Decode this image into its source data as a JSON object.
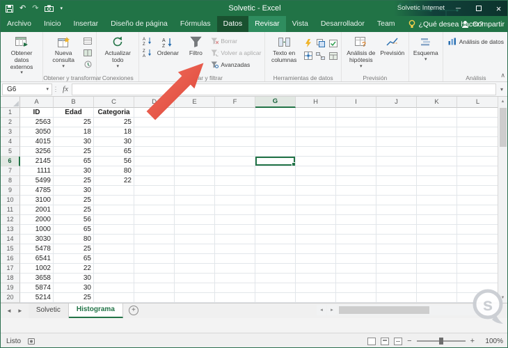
{
  "colors": {
    "excel_green": "#217346",
    "active_tab": "#19512f",
    "hover_tab": "#2f8d5f",
    "titlebar_dark": "#0c332c",
    "annotation_arrow_red": "#e8544a",
    "selection_green": "#217346"
  },
  "window": {
    "title": "Solvetic - Excel",
    "network_label": "Solvetic Internet"
  },
  "icons": {
    "undo": "↶",
    "redo": "↷",
    "caret": "▾",
    "minimize": "─",
    "close": "×",
    "left_arrow": "◄",
    "right_arrow": "►",
    "up_arrow": "▲",
    "down_arrow": "▼",
    "ellipsis": "⋮",
    "collapse_ribbon": "∧"
  },
  "ribbon_tabs": {
    "items": [
      "Archivo",
      "Inicio",
      "Insertar",
      "Diseño de página",
      "Fórmulas",
      "Datos",
      "Revisar",
      "Vista",
      "Desarrollador",
      "Team"
    ],
    "active": "Datos",
    "hovered": "Revisar",
    "tell_me": "¿Qué desea hacer?",
    "share": "Compartir"
  },
  "ribbon": {
    "groups": {
      "get_transform": "Obtener y transformar",
      "connections": "Conexiones",
      "sort_filter": "Ordenar y filtrar",
      "data_tools": "Herramientas de datos",
      "forecast": "Previsión",
      "analysis": "Análisis"
    },
    "buttons": {
      "get_external": "Obtener datos externos",
      "new_query": "Nueva consulta",
      "refresh_all": "Actualizar todo",
      "sort": "Ordenar",
      "filter": "Filtro",
      "clear": "Borrar",
      "reapply": "Volver a aplicar",
      "advanced": "Avanzadas",
      "text_to_columns": "Texto en columnas",
      "what_if": "Análisis de hipótesis",
      "forecast_sheet": "Previsión",
      "outline": "Esquema",
      "data_analysis": "Análisis de datos"
    }
  },
  "formula_bar": {
    "name_box": "G6",
    "fx": "fx",
    "formula": ""
  },
  "grid": {
    "columns": [
      "A",
      "B",
      "C",
      "D",
      "E",
      "F",
      "G",
      "H",
      "I",
      "J",
      "K",
      "L"
    ],
    "row_count": 20,
    "selected": {
      "col": "G",
      "row": 6
    },
    "cells": [
      [
        "ID",
        "Edad",
        "Categoria"
      ],
      [
        2563,
        25,
        25
      ],
      [
        3050,
        18,
        18
      ],
      [
        4015,
        30,
        30
      ],
      [
        3256,
        25,
        65
      ],
      [
        2145,
        65,
        56
      ],
      [
        1111,
        30,
        80
      ],
      [
        5499,
        25,
        22
      ],
      [
        4785,
        30,
        null
      ],
      [
        3100,
        25,
        null
      ],
      [
        2001,
        25,
        null
      ],
      [
        2000,
        56,
        null
      ],
      [
        1000,
        65,
        null
      ],
      [
        3030,
        80,
        null
      ],
      [
        5478,
        25,
        null
      ],
      [
        6541,
        65,
        null
      ],
      [
        1002,
        22,
        null
      ],
      [
        3658,
        30,
        null
      ],
      [
        5874,
        30,
        null
      ],
      [
        5214,
        25,
        null
      ]
    ]
  },
  "sheet_tabs": {
    "tabs": [
      {
        "label": "Solvetic",
        "active": false
      },
      {
        "label": "Histograma",
        "active": true
      }
    ],
    "add_label": "+"
  },
  "status_bar": {
    "mode": "Listo",
    "zoom": "100%",
    "zoom_out": "−",
    "zoom_in": "+"
  },
  "watermark": {
    "letter": "s"
  }
}
